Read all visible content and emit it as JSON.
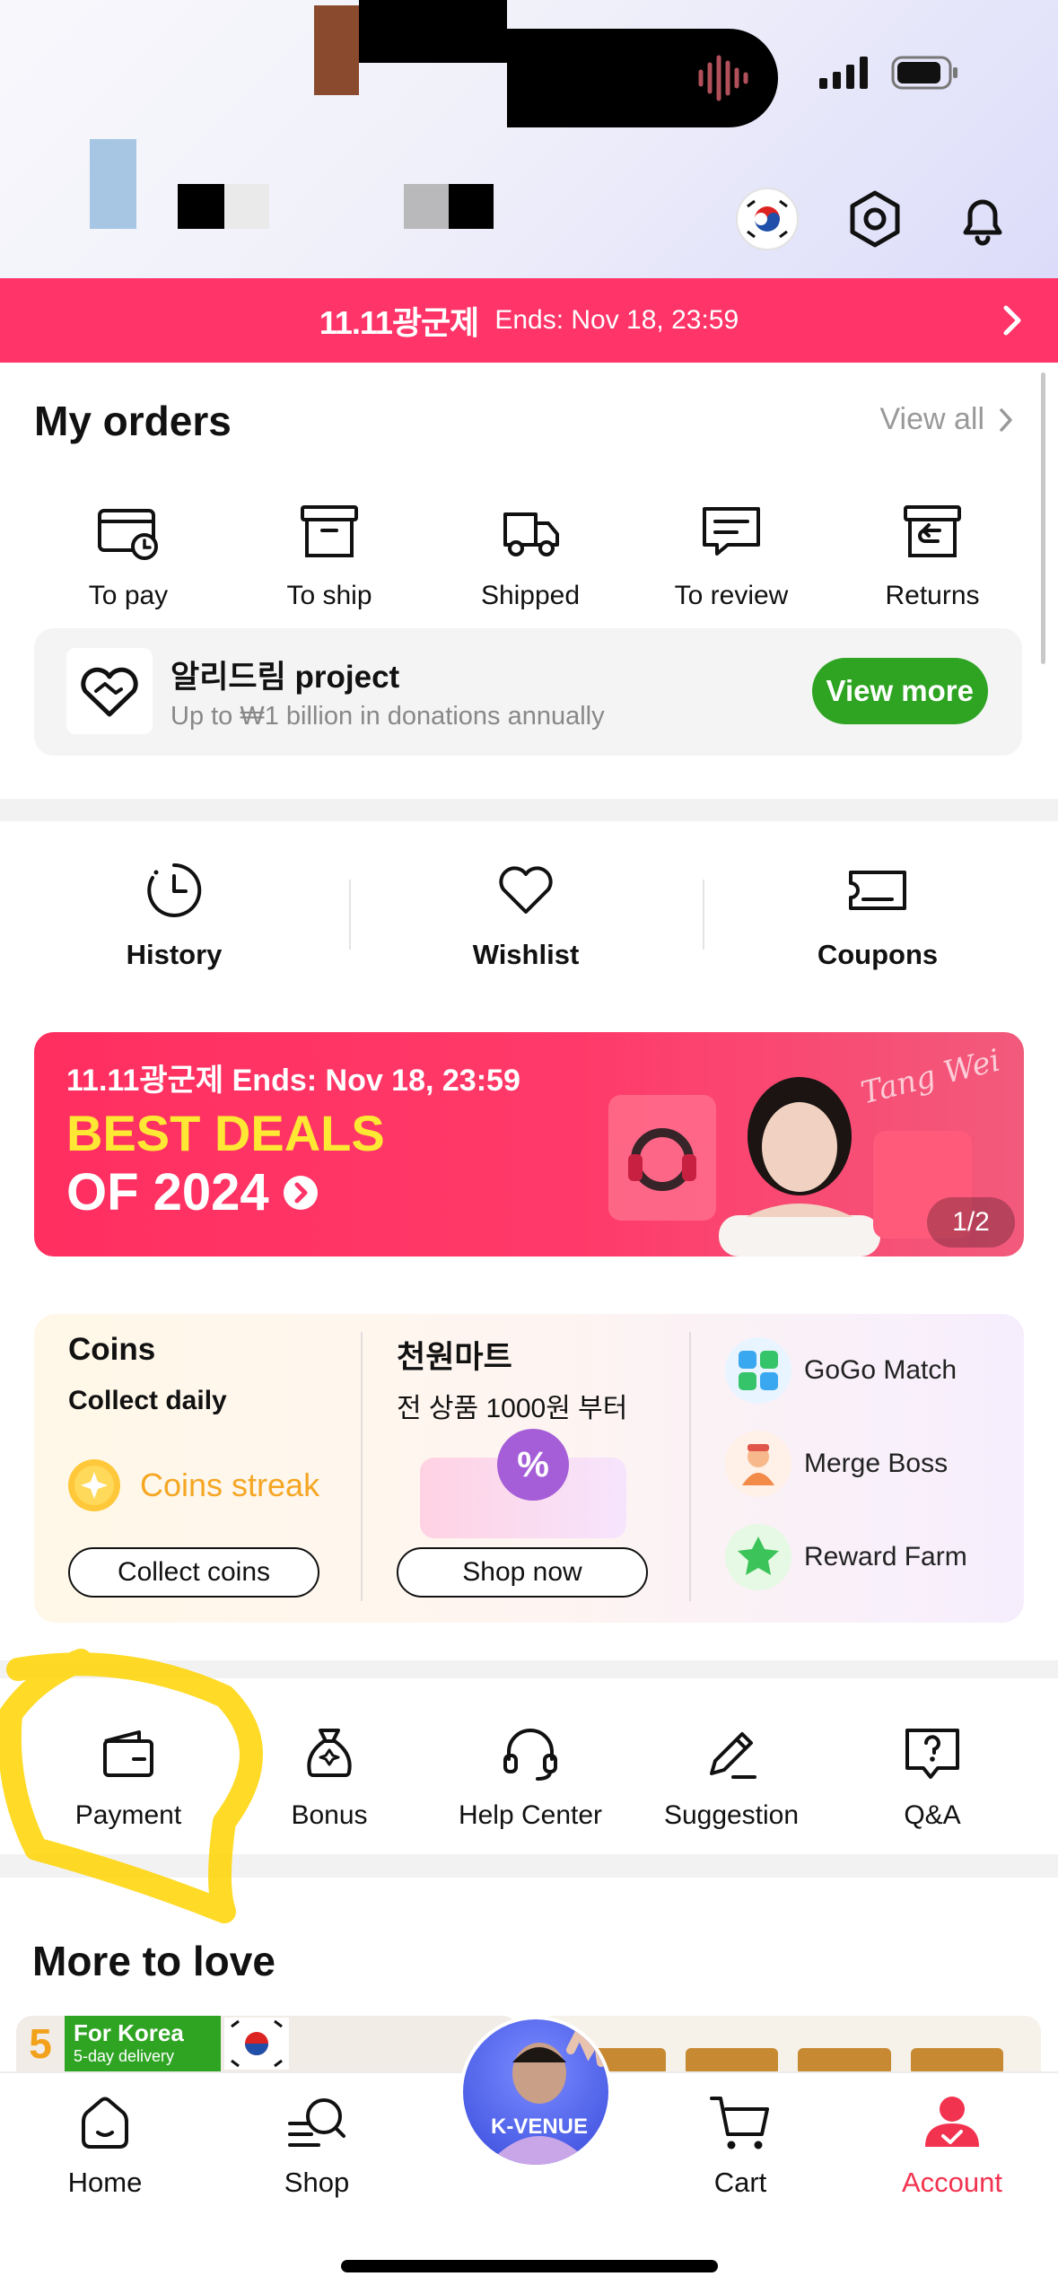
{
  "promo": {
    "brand": "11.11광군제",
    "ends": "Ends: Nov 18, 23:59"
  },
  "orders": {
    "title": "My orders",
    "view_all": "View all",
    "items": [
      {
        "label": "To pay",
        "icon": "card-clock-icon"
      },
      {
        "label": "To ship",
        "icon": "box-icon"
      },
      {
        "label": "Shipped",
        "icon": "truck-icon"
      },
      {
        "label": "To review",
        "icon": "chat-review-icon"
      },
      {
        "label": "Returns",
        "icon": "return-box-icon"
      }
    ]
  },
  "donation": {
    "title": "알리드림 project",
    "subtitle": "Up to ₩1 billion in donations annually",
    "button": "View more"
  },
  "quick": {
    "items": [
      {
        "label": "History",
        "icon": "clock-history-icon"
      },
      {
        "label": "Wishlist",
        "icon": "heart-icon"
      },
      {
        "label": "Coupons",
        "icon": "coupon-icon"
      }
    ]
  },
  "banner": {
    "top": "11.11광군제 Ends: Nov 18, 23:59",
    "line1": "BEST DEALS",
    "line2": "OF 2024",
    "signature": "Tang Wei",
    "page": "1/2"
  },
  "coins": {
    "title": "Coins",
    "subtitle": "Collect daily",
    "streak": "Coins streak",
    "button": "Collect coins"
  },
  "mart": {
    "title": "천원마트",
    "subtitle": "전 상품 1000원 부터",
    "badge": "%",
    "button": "Shop now"
  },
  "games": [
    {
      "label": "GoGo Match",
      "icon": "blocks-icon",
      "color": "#3aa8f0"
    },
    {
      "label": "Merge Boss",
      "icon": "character-icon",
      "color": "#f28a4a"
    },
    {
      "label": "Reward Farm",
      "icon": "star-icon",
      "color": "#3cc45a"
    }
  ],
  "services": [
    {
      "label": "Payment",
      "icon": "wallet-icon"
    },
    {
      "label": "Bonus",
      "icon": "money-bag-icon"
    },
    {
      "label": "Help Center",
      "icon": "headset-icon"
    },
    {
      "label": "Suggestion",
      "icon": "pencil-icon"
    },
    {
      "label": "Q&A",
      "icon": "question-bubble-icon"
    }
  ],
  "more_to_love": {
    "title": "More to love",
    "tile_badge": "For Korea",
    "tile_badge_sub": "5-day delivery",
    "tile_number": "5"
  },
  "nav": {
    "home": "Home",
    "shop": "Shop",
    "center": "K-VENUE",
    "cart": "Cart",
    "account": "Account"
  },
  "colors": {
    "accent": "#ff3468",
    "green": "#2ea422",
    "active_nav": "#f2334f",
    "highlight": "#ffd400"
  }
}
